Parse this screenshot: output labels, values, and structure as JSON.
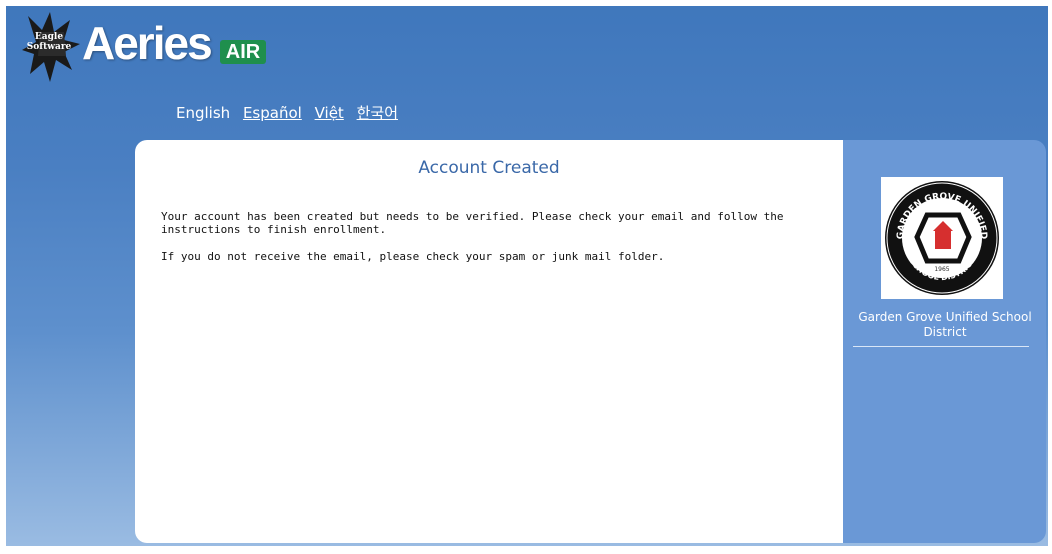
{
  "header": {
    "eagle_text": "Eagle Software",
    "brand_name": "Aeries",
    "brand_badge": "AIR"
  },
  "languages": [
    {
      "label": "English",
      "selected": true
    },
    {
      "label": "Español",
      "selected": false
    },
    {
      "label": "Việt",
      "selected": false
    },
    {
      "label": "한국어",
      "selected": false
    }
  ],
  "main": {
    "title": "Account Created",
    "paragraph1": "Your account has been created but needs to be verified. Please check your email and follow the instructions to finish enrollment.",
    "paragraph2": "If you do not receive the email, please check your spam or junk mail folder."
  },
  "side": {
    "district_name": "Garden Grove Unified School District",
    "logo_text_top": "GARDEN GROVE UNIFIED",
    "logo_text_bottom": "SCHOOL DISTRICT",
    "logo_year": "1965"
  },
  "colors": {
    "accent": "#3a68a8",
    "panel": "#6a98d6",
    "badge": "#1f8f4d"
  }
}
